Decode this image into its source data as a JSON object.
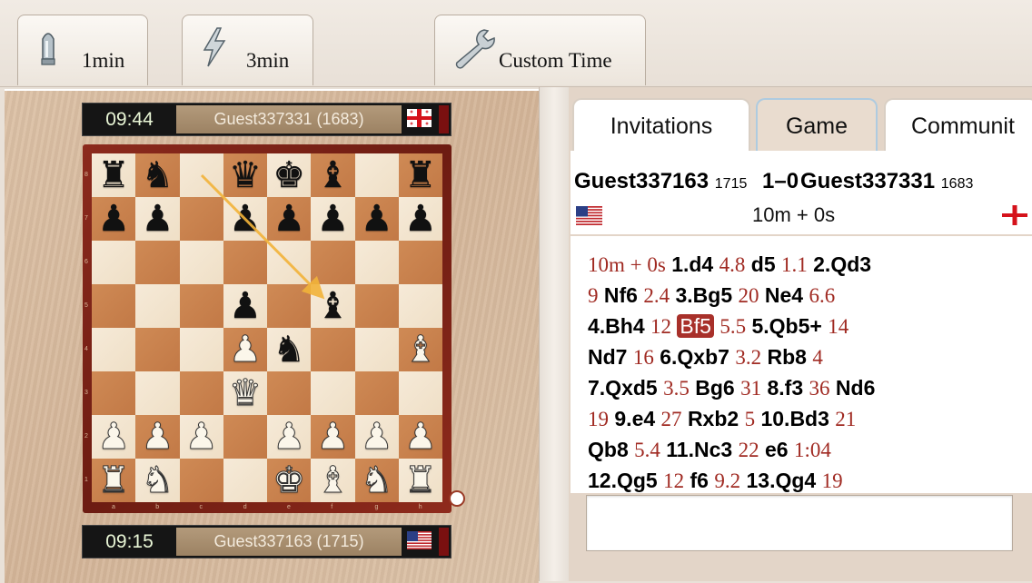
{
  "toolbar": {
    "btn_1min": "1min",
    "btn_3min": "3min",
    "btn_custom": "Custom Time"
  },
  "top_player": {
    "clock": "09:44",
    "name": "Guest337331 (1683)",
    "flag": "georgia-flag"
  },
  "bottom_player": {
    "clock": "09:15",
    "name": "Guest337163 (1715)",
    "flag": "usa-flag"
  },
  "tabs": [
    {
      "label": "Invitations",
      "active": false
    },
    {
      "label": "Game",
      "active": true
    },
    {
      "label": "Communit",
      "active": false
    }
  ],
  "game": {
    "white_name": "Guest337163",
    "white_rating": "1715",
    "result": "1–0",
    "black_name": "Guest337331",
    "black_rating": "1683",
    "time_control": "10m + 0s"
  },
  "move_lines": [
    [
      {
        "t": "tm",
        "v": "10m + 0s"
      },
      {
        "t": "mv",
        "v": "1.d4"
      },
      {
        "t": "tm",
        "v": "4.8"
      },
      {
        "t": "mv",
        "v": "d5"
      },
      {
        "t": "tm",
        "v": "1.1"
      },
      {
        "t": "mv",
        "v": "2.Qd3"
      }
    ],
    [
      {
        "t": "tm",
        "v": "9"
      },
      {
        "t": "mv",
        "v": "Nf6"
      },
      {
        "t": "tm",
        "v": "2.4"
      },
      {
        "t": "mv",
        "v": "3.Bg5"
      },
      {
        "t": "tm",
        "v": "20"
      },
      {
        "t": "mv",
        "v": "Ne4"
      },
      {
        "t": "tm",
        "v": "6.6"
      }
    ],
    [
      {
        "t": "mv",
        "v": "4.Bh4"
      },
      {
        "t": "tm",
        "v": "12"
      },
      {
        "t": "hl",
        "v": "Bf5"
      },
      {
        "t": "tm",
        "v": "5.5"
      },
      {
        "t": "mv",
        "v": "5.Qb5+"
      },
      {
        "t": "tm",
        "v": "14"
      }
    ],
    [
      {
        "t": "mv",
        "v": "Nd7"
      },
      {
        "t": "tm",
        "v": "16"
      },
      {
        "t": "mv",
        "v": "6.Qxb7"
      },
      {
        "t": "tm",
        "v": "3.2"
      },
      {
        "t": "mv",
        "v": "Rb8"
      },
      {
        "t": "tm",
        "v": "4"
      }
    ],
    [
      {
        "t": "mv",
        "v": "7.Qxd5"
      },
      {
        "t": "tm",
        "v": "3.5"
      },
      {
        "t": "mv",
        "v": "Bg6"
      },
      {
        "t": "tm",
        "v": "31"
      },
      {
        "t": "mv",
        "v": "8.f3"
      },
      {
        "t": "tm",
        "v": "36"
      },
      {
        "t": "mv",
        "v": "Nd6"
      }
    ],
    [
      {
        "t": "tm",
        "v": "19"
      },
      {
        "t": "mv",
        "v": "9.e4"
      },
      {
        "t": "tm",
        "v": "27"
      },
      {
        "t": "mv",
        "v": "Rxb2"
      },
      {
        "t": "tm",
        "v": "5"
      },
      {
        "t": "mv",
        "v": "10.Bd3"
      },
      {
        "t": "tm",
        "v": "21"
      }
    ],
    [
      {
        "t": "mv",
        "v": "Qb8"
      },
      {
        "t": "tm",
        "v": "5.4"
      },
      {
        "t": "mv",
        "v": "11.Nc3"
      },
      {
        "t": "tm",
        "v": "22"
      },
      {
        "t": "mv",
        "v": "e6"
      },
      {
        "t": "tm",
        "v": "1:04"
      }
    ],
    [
      {
        "t": "mv",
        "v": "12.Qg5"
      },
      {
        "t": "tm",
        "v": "12"
      },
      {
        "t": "mv",
        "v": "f6"
      },
      {
        "t": "tm",
        "v": "9.2"
      },
      {
        "t": "mv",
        "v": "13.Qg4"
      },
      {
        "t": "tm",
        "v": "19"
      }
    ]
  ],
  "board": {
    "files": [
      "a",
      "b",
      "c",
      "d",
      "e",
      "f",
      "g",
      "h"
    ],
    "ranks": [
      "8",
      "7",
      "6",
      "5",
      "4",
      "3",
      "2",
      "1"
    ],
    "rows": [
      "rn.qkb.r",
      "pp.ppppp",
      "........",
      "...p.b..",
      "...Pn..B",
      "...Q....",
      "PPP.PPPP",
      "RN..KBNR"
    ],
    "last_move": {
      "from": "c8",
      "to": "f5"
    },
    "arrow_color": "#f2b33a"
  },
  "colors": {
    "light_square": "#f4e7d3",
    "dark_square": "#c98050",
    "frame": "#7d2418",
    "move_time_color": "#a02a22",
    "highlight_move_bg": "#a8302a"
  }
}
